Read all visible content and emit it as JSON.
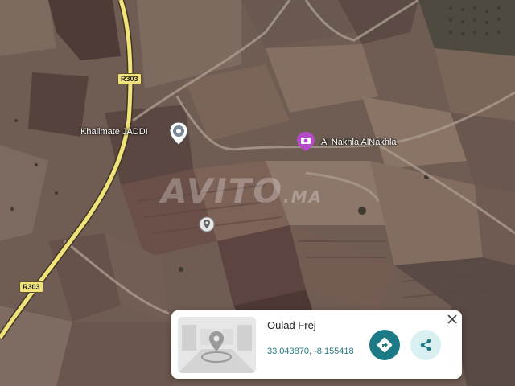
{
  "map": {
    "roads": [
      {
        "label": "R303"
      },
      {
        "label": "R303"
      }
    ],
    "places": [
      {
        "name": "Khaiimate JADDI",
        "pin": "location-pin-icon"
      },
      {
        "name": "Al Nakhla AlNakhla",
        "pin": "camera-pin-icon"
      }
    ],
    "watermark": {
      "text": "AVITO",
      "suffix": ".MA"
    }
  },
  "card": {
    "title": "Oulad Frej",
    "coordinates": "33.043870, -8.155418",
    "thumbnail_icon": "street-view-placeholder-icon",
    "directions_icon": "directions-icon",
    "share_icon": "share-icon",
    "close_icon": "close-icon"
  },
  "colors": {
    "road": "#f2e27a",
    "directions_button": "#1b7a86",
    "share_button_bg": "#d9f0f3",
    "coords_text": "#2b7c85",
    "camera_pin": "#b34ac7"
  }
}
